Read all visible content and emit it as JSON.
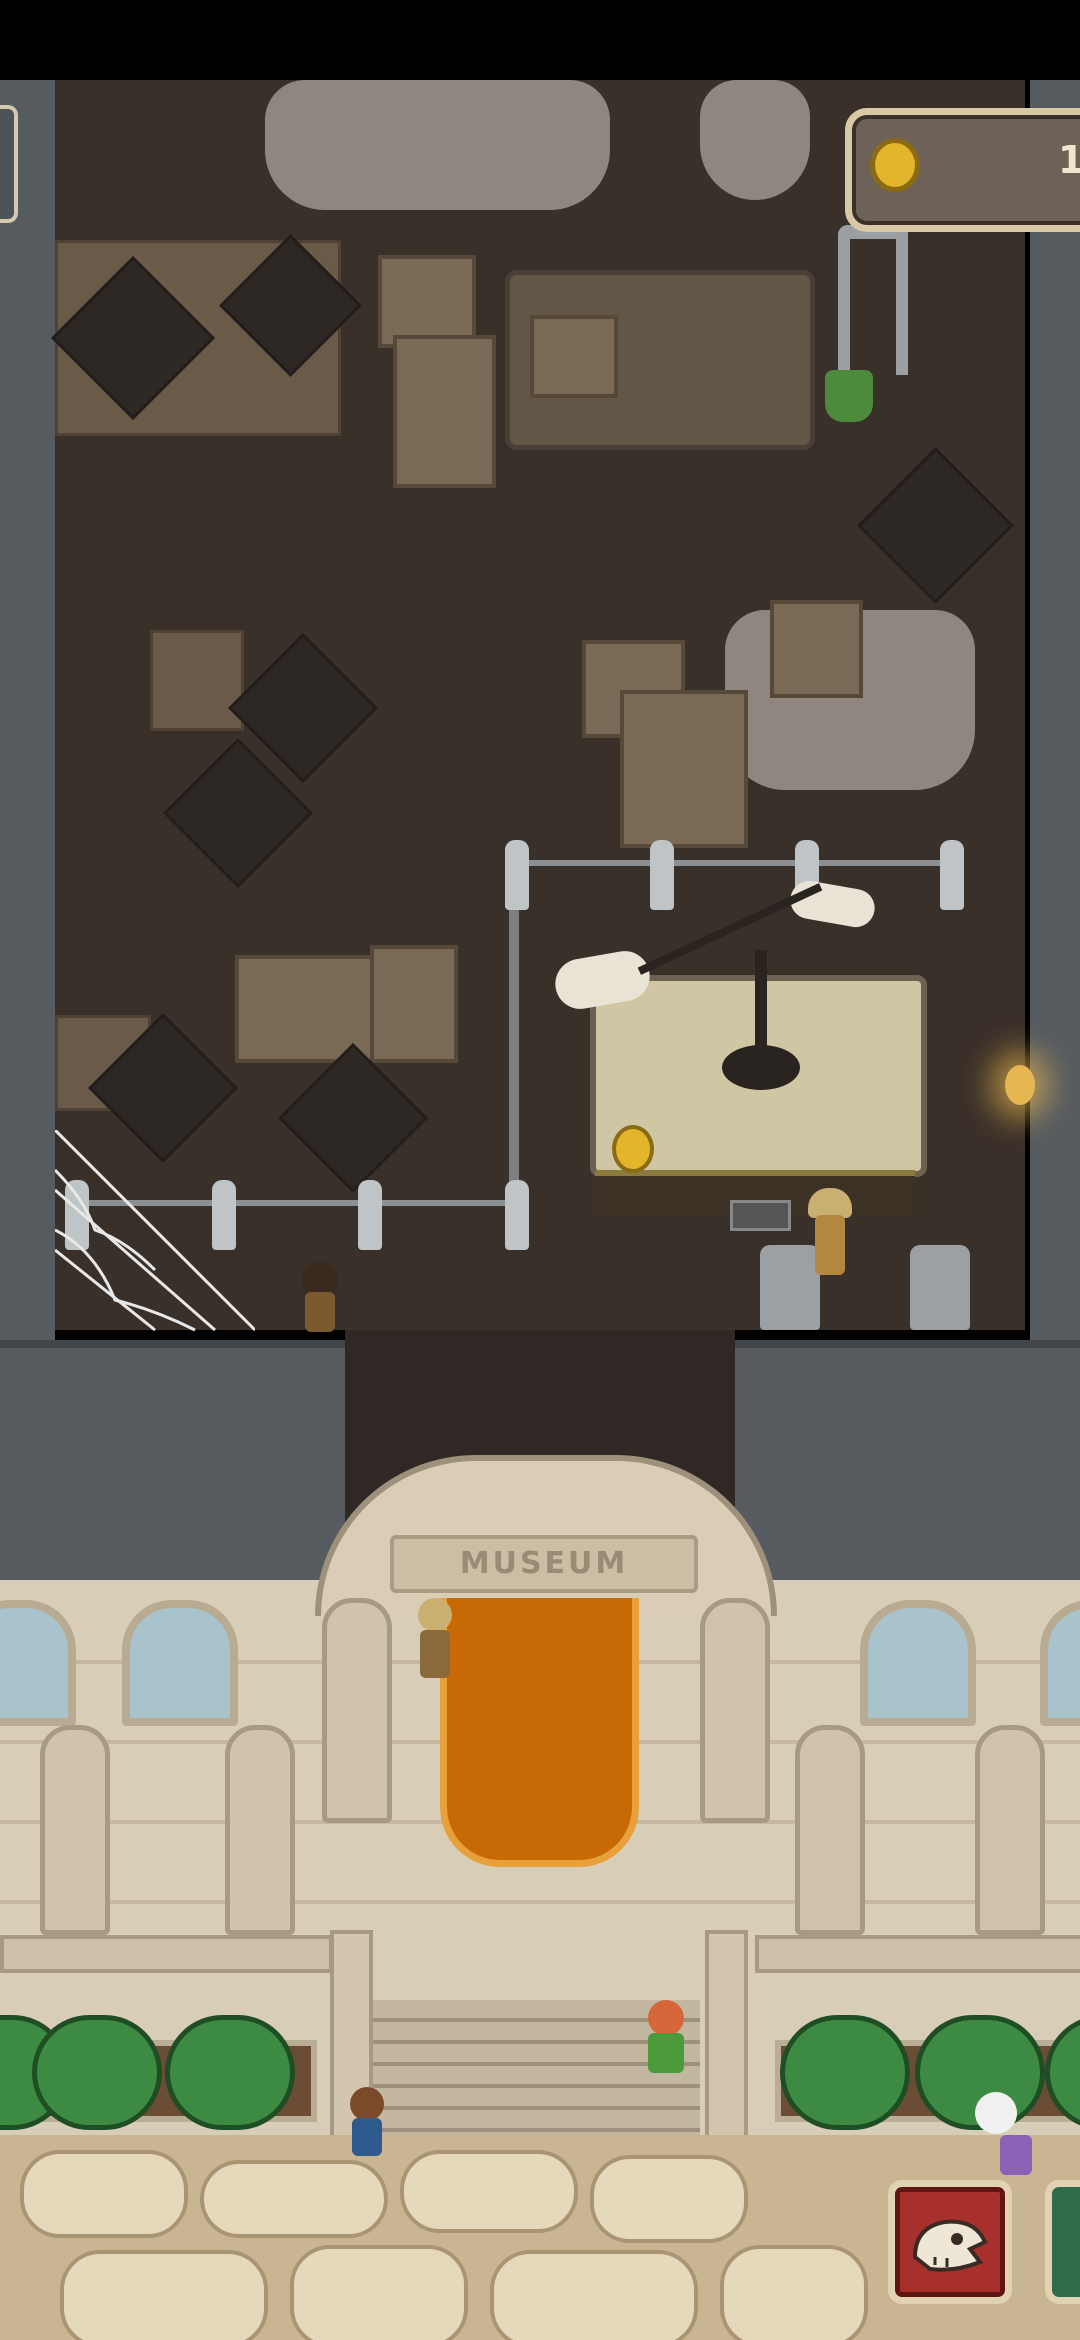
{
  "hud": {
    "coin_count": "1",
    "coin_icon": "coin-icon",
    "fossil_button_icon": "fossil-skull-icon"
  },
  "scene": {
    "sign_text": "MUSEUM"
  },
  "colors": {
    "wall": "#565b60",
    "floor": "#3a302a",
    "carpet": "#c76a06",
    "facade": "#d8cdb7",
    "bush": "#3d8a43",
    "hud_button": "#a7302c",
    "coin": "#e3b52a"
  }
}
